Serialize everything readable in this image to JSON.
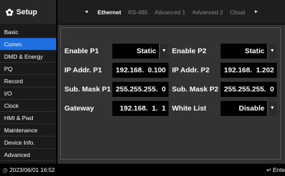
{
  "sidebar": {
    "title": "Setup",
    "items": [
      "Basic",
      "Comm.",
      "DMD & Energy",
      "PQ",
      "Record",
      "I/O",
      "Clock",
      "HMI & Pwd",
      "Maintenance",
      "Device Info.",
      "Advanced"
    ],
    "active_index": 1
  },
  "tabs": {
    "prev_arrow": "◄",
    "next_arrow": "►",
    "items": [
      "Ethernet",
      "RS-485",
      "Advanced 1",
      "Advanced 2",
      "Cloud"
    ],
    "active_index": 0
  },
  "form": {
    "enable_p1": {
      "label": "Enable P1",
      "value": "Static"
    },
    "enable_p2": {
      "label": "Enable P2",
      "value": "Static"
    },
    "ip_p1": {
      "label": "IP Addr. P1",
      "value": "192.168.  0.100"
    },
    "ip_p2": {
      "label": "IP Addr. P2",
      "value": "192.168.  1.202"
    },
    "mask_p1": {
      "label": "Sub. Mask P1",
      "value": "255.255.255.  0"
    },
    "mask_p2": {
      "label": "Sub. Mask P2",
      "value": "255.255.255.  0"
    },
    "gateway": {
      "label": "Gateway",
      "value": "192.168.  1.  1"
    },
    "white_list": {
      "label": "White List",
      "value": "Disable"
    }
  },
  "status": {
    "datetime": "2023/06/01 16:52",
    "enter_hint": "↵ Ente"
  }
}
